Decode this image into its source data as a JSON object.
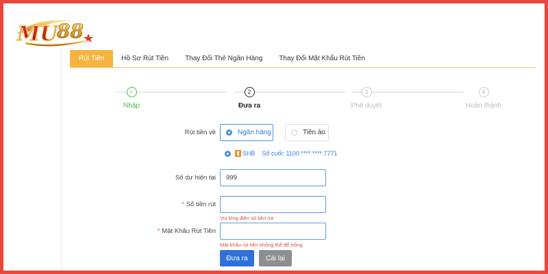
{
  "tabs": [
    {
      "label": "Rút Tiền",
      "active": true
    },
    {
      "label": "Hồ Sơ Rút Tiền",
      "active": false
    },
    {
      "label": "Thay Đổi Thẻ Ngân Hàng",
      "active": false
    },
    {
      "label": "Thay Đổi Mật Khẩu Rút Tiền",
      "active": false
    }
  ],
  "steps": [
    {
      "number": "✓",
      "label": "Nhập",
      "state": "done"
    },
    {
      "number": "2",
      "label": "Đưa ra",
      "state": "current"
    },
    {
      "number": "3",
      "label": "Phê duyệt",
      "state": "pending"
    },
    {
      "number": "4",
      "label": "Hoàn thành",
      "state": "pending"
    }
  ],
  "form": {
    "withdraw_to_label": "Rút tiền về",
    "option_bank": "Ngân hàng",
    "option_crypto": "Tiền ảo",
    "bank_name": "SHB",
    "bank_last_digits": "Số cuối:  1100 **** **** 7771",
    "balance_label": "Số dư hiện tại",
    "balance_value": "999",
    "amount_label": "Số tiền rút",
    "amount_error": "Vui lòng điền số tiền rút",
    "password_label": "Mật Khẩu Rút Tiền",
    "password_error": "Mật khẩu rút tiền không thể để trống",
    "required_mark": "*",
    "submit_label": "Đưa ra",
    "reset_label": "Cài lại"
  },
  "colors": {
    "frame": "#e8473b",
    "tab_active": "#f6b33e",
    "step_done": "#4cb848",
    "primary": "#2e72d8",
    "error": "#e04b4b"
  },
  "logo": {
    "text": "MU88"
  }
}
